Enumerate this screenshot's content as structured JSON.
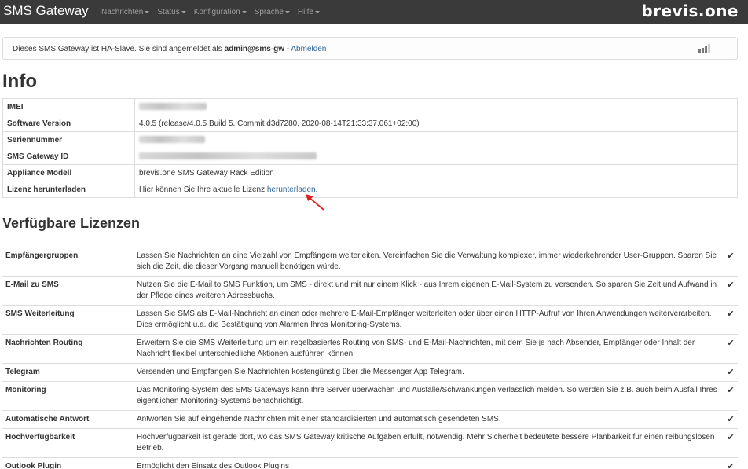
{
  "navbar": {
    "brand": "SMS Gateway",
    "menu": [
      "Nachrichten",
      "Status",
      "Konfiguration",
      "Sprache",
      "Hilfe"
    ],
    "logo": "brevis.one"
  },
  "banner": {
    "text_before": "Dieses SMS Gateway ist HA-Slave. Sie sind angemeldet als ",
    "user": "admin@sms-gw",
    "separator": " - ",
    "logout": "Abmelden"
  },
  "info": {
    "title": "Info",
    "rows": [
      {
        "label": "IMEI",
        "value": ""
      },
      {
        "label": "Software Version",
        "value": "4.0.5 (release/4.0.5 Build 5, Commit d3d7280, 2020-08-14T21:33:37.061+02:00)"
      },
      {
        "label": "Seriennummer",
        "value": ""
      },
      {
        "label": "SMS Gateway ID",
        "value": ""
      },
      {
        "label": "Appliance Modell",
        "value": "brevis.one SMS Gateway Rack Edition"
      },
      {
        "label": "Lizenz herunterladen",
        "value": "Hier können Sie Ihre aktuelle Lizenz ",
        "link": "herunterladen",
        "suffix": "."
      }
    ]
  },
  "licenses": {
    "title": "Verfügbare Lizenzen",
    "check_icon": "check-icon",
    "rows": [
      {
        "name": "Empfängergruppen",
        "desc": "Lassen Sie Nachrichten an eine Vielzahl von Empfängern weiterleiten. Vereinfachen Sie die Verwaltung komplexer, immer wiederkehrender User-Gruppen. Sparen Sie sich die Zeit, die dieser Vorgang manuell benötigen würde."
      },
      {
        "name": "E-Mail zu SMS",
        "desc": "Nutzen Sie die E-Mail to SMS Funktion, um SMS - direkt und mit nur einem Klick - aus Ihrem eigenen E-Mail-System zu versenden. So sparen Sie Zeit und Aufwand in der Pflege eines weiteren Adressbuchs."
      },
      {
        "name": "SMS Weiterleitung",
        "desc": "Lassen Sie SMS als E-Mail-Nachricht an einen oder mehrere E-Mail-Empfänger weiterleiten oder über einen HTTP-Aufruf von Ihren Anwendungen weiterverarbeiten. Dies ermöglicht u.a. die Bestätigung von Alarmen Ihres Monitoring-Systems."
      },
      {
        "name": "Nachrichten Routing",
        "desc": "Erweitern Sie die SMS Weiterleitung um ein regelbasiertes Routing von SMS- und E-Mail-Nachrichten, mit dem Sie je nach Absender, Empfänger oder Inhalt der Nachricht flexibel unterschiedliche Aktionen ausführen können."
      },
      {
        "name": "Telegram",
        "desc": "Versenden und Empfangen Sie Nachrichten kostengünstig über die Messenger App Telegram."
      },
      {
        "name": "Monitoring",
        "desc": "Das Monitoring-System des SMS Gateways kann Ihre Server überwachen und Ausfälle/Schwankungen verlässlich melden. So werden Sie z.B. auch beim Ausfall Ihres eigentlichen Monitoring-Systems benachrichtigt."
      },
      {
        "name": "Automatische Antwort",
        "desc": "Antworten Sie auf eingehende Nachrichten mit einer standardisierten und automatisch gesendeten SMS."
      },
      {
        "name": "Hochverfügbarkeit",
        "desc": "Hochverfügbarkeit ist gerade dort, wo das SMS Gateway kritische Aufgaben erfüllt, notwendig. Mehr Sicherheit bedeutete bessere Planbarkeit für einen reibungslosen Betrieb."
      },
      {
        "name": "Outlook Plugin",
        "desc": "Ermöglicht den Einsatz des Outlook Plugins"
      }
    ]
  }
}
